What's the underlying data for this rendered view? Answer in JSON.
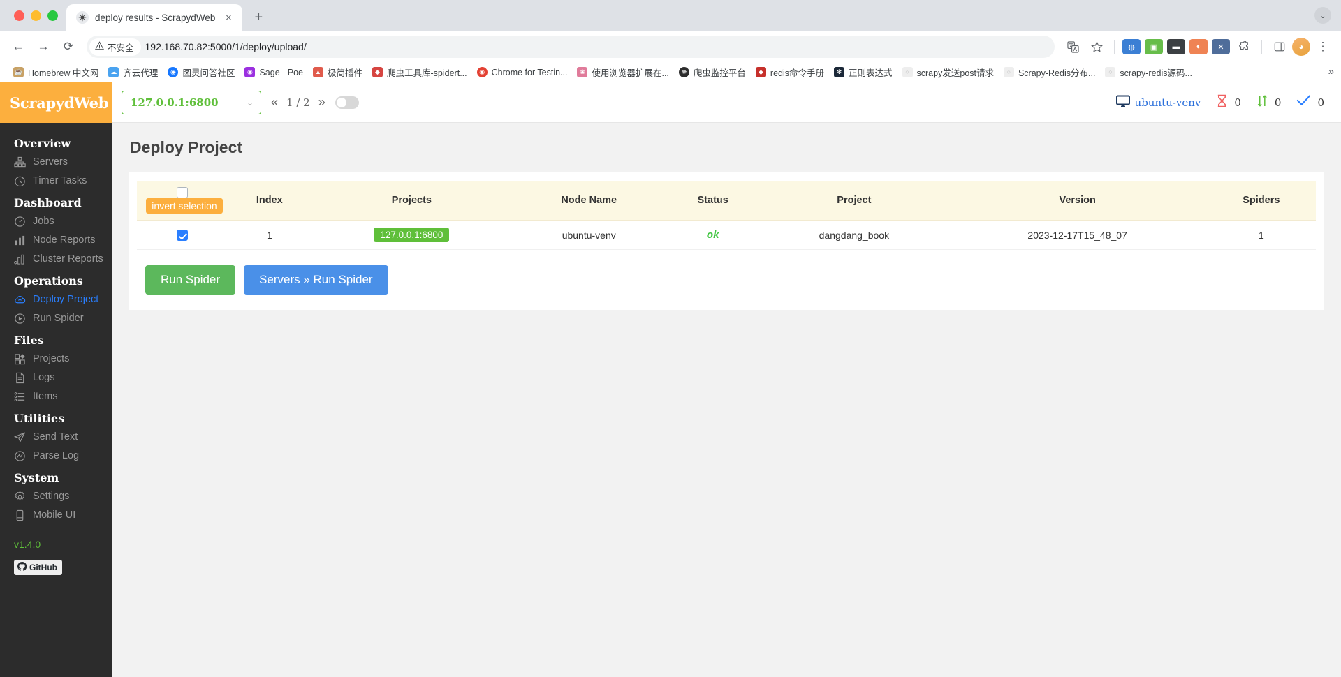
{
  "browser": {
    "tab": {
      "title": "deploy results - ScrapydWeb",
      "favicon": "spider-icon",
      "close": "×"
    },
    "new_tab": "+",
    "window_menu": "⌄",
    "nav": {
      "back": "←",
      "forward": "→",
      "reload": "⟳"
    },
    "omnibox": {
      "security_label": "不安全",
      "security_icon": "warning-triangle-icon",
      "url": "192.168.70.82:5000/1/deploy/upload/",
      "translate_icon": "translate-icon",
      "bookmark_icon": "star-icon"
    },
    "extensions": [
      {
        "name": "extension-globe",
        "glyph": "●",
        "color": "#3b7fd4"
      },
      {
        "name": "extension-green",
        "glyph": "■",
        "color": "#5fbf3a"
      },
      {
        "name": "extension-dark",
        "glyph": "▬",
        "color": "#3c4043"
      },
      {
        "name": "extension-colorful",
        "glyph": "◐",
        "color": "#ef8354"
      },
      {
        "name": "extension-x",
        "glyph": "✕",
        "color": "#4f6d9a"
      },
      {
        "name": "extension-puzzle",
        "glyph": "❖",
        "color": "#5f6368"
      }
    ],
    "sidepanel_icon": "sidepanel-icon",
    "profile_icon": "profile-avatar",
    "menu_icon": "kebab-menu-icon",
    "bookmarks": [
      {
        "label": "Homebrew 中文网",
        "color": "#c8a165",
        "glyph": "☕"
      },
      {
        "label": "齐云代理",
        "color": "#4aa3f0",
        "glyph": "☁"
      },
      {
        "label": "图灵问答社区",
        "color": "#1677ff",
        "glyph": "◉"
      },
      {
        "label": "Sage - Poe",
        "color": "#9b30e0",
        "glyph": "◉"
      },
      {
        "label": "极简插件",
        "color": "#e05b4c",
        "glyph": "▲"
      },
      {
        "label": "爬虫工具库-spidert...",
        "color": "#d64541",
        "glyph": "♦"
      },
      {
        "label": "Chrome for Testin...",
        "color": "#e34133",
        "glyph": "◉"
      },
      {
        "label": "使用浏览器扩展在...",
        "color": "#e07b9a",
        "glyph": "❀"
      },
      {
        "label": "爬虫监控平台",
        "color": "#2c2c2c",
        "glyph": "☸"
      },
      {
        "label": "redis命令手册",
        "color": "#c6302b",
        "glyph": "◆"
      },
      {
        "label": "正则表达式",
        "color": "#1b2838",
        "glyph": "✻"
      },
      {
        "label": "scrapy发送post请求",
        "color": "#e4e4e4",
        "glyph": "○"
      },
      {
        "label": "Scrapy-Redis分布...",
        "color": "#e4e4e4",
        "glyph": "○"
      },
      {
        "label": "scrapy-redis源码...",
        "color": "#e4e4e4",
        "glyph": "○"
      }
    ],
    "bookmarks_overflow": "»"
  },
  "app": {
    "brand": "ScrapydWeb",
    "version": "v1.4.0",
    "github_label": "GitHub"
  },
  "topbar": {
    "node_select_value": "127.0.0.1:6800",
    "node_select_chevron": "⌄",
    "pager": {
      "first": "«",
      "page": "1 / 2",
      "last": "»"
    },
    "auto_toggle": "off",
    "current_node": "ubuntu-venv",
    "stats": [
      {
        "name": "pending",
        "icon": "hourglass-icon",
        "value": "0",
        "color": "#f06060"
      },
      {
        "name": "running",
        "icon": "arrows-updown-icon",
        "value": "0",
        "color": "#5fbf3a"
      },
      {
        "name": "finished",
        "icon": "check-icon",
        "value": "0",
        "color": "#2a7fff"
      }
    ]
  },
  "sidebar": {
    "groups": [
      {
        "title": "Overview",
        "items": [
          {
            "label": "Servers",
            "icon": "sitemap-icon",
            "active": false
          },
          {
            "label": "Timer Tasks",
            "icon": "clock-icon",
            "active": false
          }
        ]
      },
      {
        "title": "Dashboard",
        "items": [
          {
            "label": "Jobs",
            "icon": "gauge-icon",
            "active": false
          },
          {
            "label": "Node Reports",
            "icon": "bar-chart-icon",
            "active": false
          },
          {
            "label": "Cluster Reports",
            "icon": "bar-chart-alt-icon",
            "active": false
          }
        ]
      },
      {
        "title": "Operations",
        "items": [
          {
            "label": "Deploy Project",
            "icon": "cloud-upload-icon",
            "active": true
          },
          {
            "label": "Run Spider",
            "icon": "play-circle-icon",
            "active": false
          }
        ]
      },
      {
        "title": "Files",
        "items": [
          {
            "label": "Projects",
            "icon": "grid-icon",
            "active": false
          },
          {
            "label": "Logs",
            "icon": "file-icon",
            "active": false
          },
          {
            "label": "Items",
            "icon": "list-icon",
            "active": false
          }
        ]
      },
      {
        "title": "Utilities",
        "items": [
          {
            "label": "Send Text",
            "icon": "paper-plane-icon",
            "active": false
          },
          {
            "label": "Parse Log",
            "icon": "analytics-circle-icon",
            "active": false
          }
        ]
      },
      {
        "title": "System",
        "items": [
          {
            "label": "Settings",
            "icon": "gear-icon",
            "active": false
          },
          {
            "label": "Mobile UI",
            "icon": "mobile-icon",
            "active": false
          }
        ]
      }
    ]
  },
  "main": {
    "title": "Deploy Project",
    "table": {
      "invert_selection_label": "invert selection",
      "header_checkbox_checked": false,
      "columns": [
        "Index",
        "Projects",
        "Node Name",
        "Status",
        "Project",
        "Version",
        "Spiders"
      ],
      "rows": [
        {
          "checked": true,
          "index": "1",
          "projects": "127.0.0.1:6800",
          "node_name": "ubuntu-venv",
          "status": "ok",
          "project": "dangdang_book",
          "version": "2023-12-17T15_48_07",
          "spiders": "1"
        }
      ]
    },
    "buttons": [
      {
        "label": "Run Spider",
        "style": "green"
      },
      {
        "label": "Servers » Run Spider",
        "style": "blue"
      }
    ]
  },
  "colors": {
    "brand_orange": "#fcaf3e",
    "accent_green": "#5fbf3a",
    "accent_blue": "#2a7fff",
    "sidebar_bg": "#2c2c2c"
  }
}
